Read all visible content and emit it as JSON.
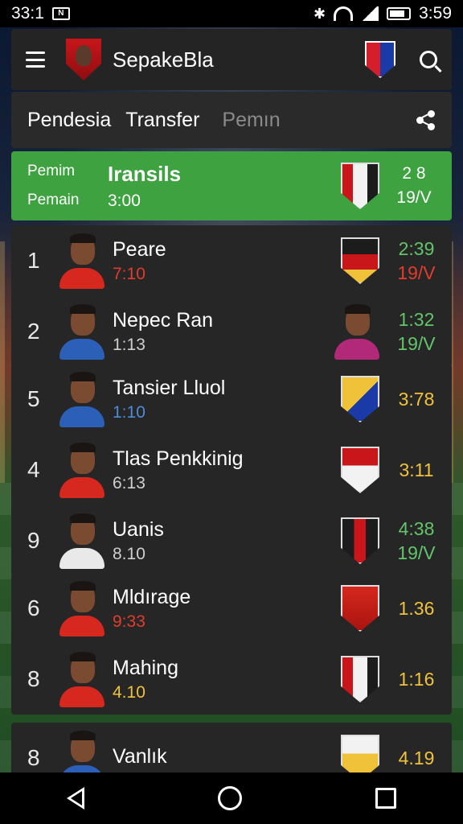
{
  "status_bar": {
    "time_left": "33:1",
    "time_right": "3:59",
    "notification_label": "N"
  },
  "header": {
    "title": "SepakeBla"
  },
  "tabs": [
    {
      "label": "Pendesia"
    },
    {
      "label": "Transfer"
    },
    {
      "label": "Pemın"
    }
  ],
  "highlight": {
    "label_top": "Pemim",
    "label_bottom": "Pemain",
    "title": "Iransils",
    "time": "3:00",
    "stat_top": "2 8",
    "stat_bottom": "19/V"
  },
  "rows": [
    {
      "rank": "1",
      "name": "Peare",
      "time": "7:10",
      "stat_top": "2:39",
      "stat_bottom": "19/V",
      "time_color": "#e33b2e",
      "stat_top_color": "#63c46a",
      "stat_bottom_color": "#e33b2e",
      "shirt": "red",
      "badge": "linear-gradient(180deg,#1c1c1c 0 35%,#c8161b 35% 70%,#f0c23a 70%)"
    },
    {
      "rank": "2",
      "name": "Nepec Ran",
      "time": "1:13",
      "stat_top": "1:32",
      "stat_bottom": "19/V",
      "time_color": "#cfcfcf",
      "stat_top_color": "#63c46a",
      "stat_bottom_color": "#63c46a",
      "shirt": "blue",
      "badge": "face"
    },
    {
      "rank": "5",
      "name": "Tansier Lluol",
      "time": "1:10",
      "stat_top": "3:78",
      "stat_bottom": "",
      "time_color": "#4d8ad8",
      "stat_top_color": "#f0c23a",
      "stat_bottom_color": "#f0c23a",
      "shirt": "blue",
      "badge": "linear-gradient(135deg,#f0c23a 0 50%,#1a3aa8 50%)"
    },
    {
      "rank": "4",
      "name": "Tlas Penkkinig",
      "time": "6:13",
      "stat_top": "3:11",
      "stat_bottom": "",
      "time_color": "#cfcfcf",
      "stat_top_color": "#f0c23a",
      "stat_bottom_color": "#f0c23a",
      "shirt": "red",
      "badge": "linear-gradient(180deg,#c8161b 0 40%,#f2f2f2 40%)"
    },
    {
      "rank": "9",
      "name": "Uanis",
      "time": "8.10",
      "stat_top": "4:38",
      "stat_bottom": "19/V",
      "time_color": "#cfcfcf",
      "stat_top_color": "#63c46a",
      "stat_bottom_color": "#63c46a",
      "shirt": "white",
      "badge": "linear-gradient(90deg,#1c1c1c 0 33%,#c8161b 33% 66%,#1c1c1c 66%)"
    },
    {
      "rank": "6",
      "name": "Mldırage",
      "time": "9:33",
      "stat_top": "1.36",
      "stat_bottom": "",
      "time_color": "#e33b2e",
      "stat_top_color": "#f0c23a",
      "stat_bottom_color": "#f0c23a",
      "shirt": "red",
      "badge": "linear-gradient(180deg,#d6281e,#a9140f)"
    },
    {
      "rank": "8",
      "name": "Mahing",
      "time": "4.10",
      "stat_top": "1:16",
      "stat_bottom": "",
      "time_color": "#f0c23a",
      "stat_top_color": "#f0c23a",
      "stat_bottom_color": "#f0c23a",
      "shirt": "red",
      "badge": "linear-gradient(90deg,#c8161b 0 30%,#f2f2f2 30% 70%,#1c1c1c 70%)"
    },
    {
      "rank": "8",
      "name": "Vanlık",
      "time": "",
      "stat_top": "4.19",
      "stat_bottom": "",
      "time_color": "#f0c23a",
      "stat_top_color": "#f0c23a",
      "stat_bottom_color": "#f0c23a",
      "shirt": "blue",
      "badge": "linear-gradient(180deg,#f2f2f2 0 40%,#f0c23a 40%)"
    }
  ]
}
